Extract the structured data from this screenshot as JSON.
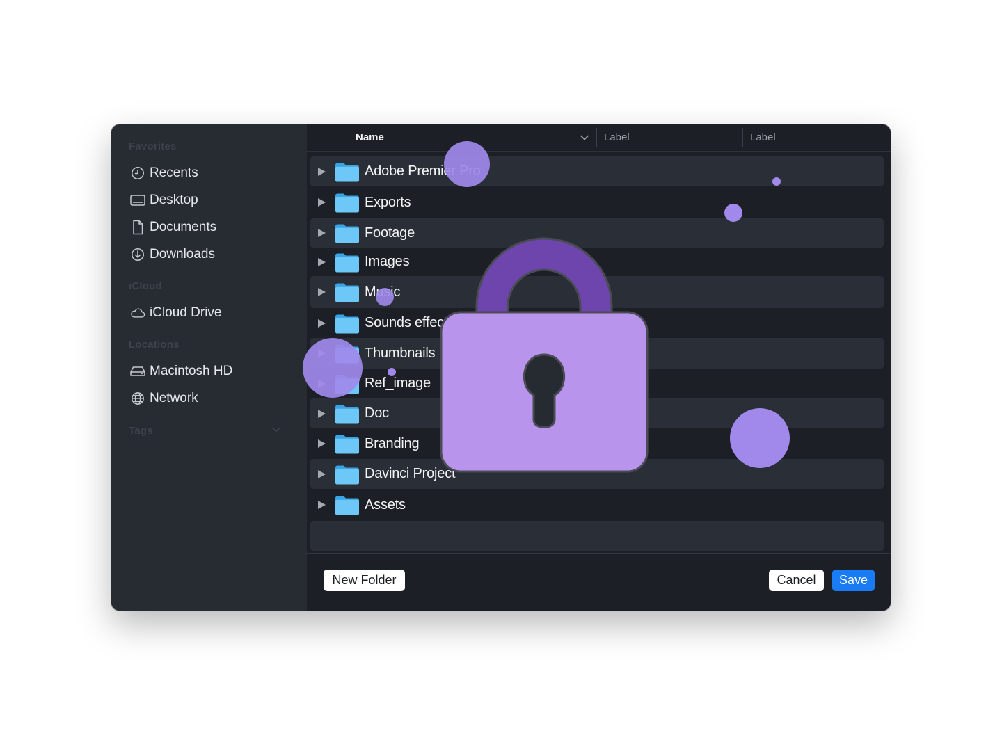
{
  "sidebar": {
    "sections": {
      "favorites": "Favorites",
      "icloud": "iCloud",
      "locations": "Locations",
      "tags": "Tags"
    },
    "favorites": [
      {
        "label": "Recents",
        "icon": "clock-icon"
      },
      {
        "label": "Desktop",
        "icon": "desktop-icon"
      },
      {
        "label": "Documents",
        "icon": "document-icon"
      },
      {
        "label": "Downloads",
        "icon": "download-icon"
      }
    ],
    "icloud": [
      {
        "label": "iCloud Drive",
        "icon": "cloud-icon"
      }
    ],
    "locations": [
      {
        "label": "Macintosh HD",
        "icon": "drive-icon"
      },
      {
        "label": "Network",
        "icon": "globe-icon"
      }
    ]
  },
  "header": {
    "name": "Name",
    "label1": "Label",
    "label2": "Label"
  },
  "files": [
    {
      "name": "Adobe Premier Pro"
    },
    {
      "name": "Exports"
    },
    {
      "name": "Footage"
    },
    {
      "name": "Images"
    },
    {
      "name": "Music"
    },
    {
      "name": "Sounds effects"
    },
    {
      "name": "Thumbnails"
    },
    {
      "name": "Ref_image"
    },
    {
      "name": "Doc"
    },
    {
      "name": "Branding"
    },
    {
      "name": "Davinci Project"
    },
    {
      "name": "Assets"
    }
  ],
  "footer": {
    "new_folder": "New Folder",
    "cancel": "Cancel",
    "save": "Save"
  },
  "colors": {
    "accent": "#1a7cf5",
    "folder": "#6ec8f7",
    "lock_body": "#b894ec",
    "lock_shackle": "#6d45ad",
    "dots": "#a089ea"
  },
  "overlay": {
    "icon": "lock-icon"
  }
}
